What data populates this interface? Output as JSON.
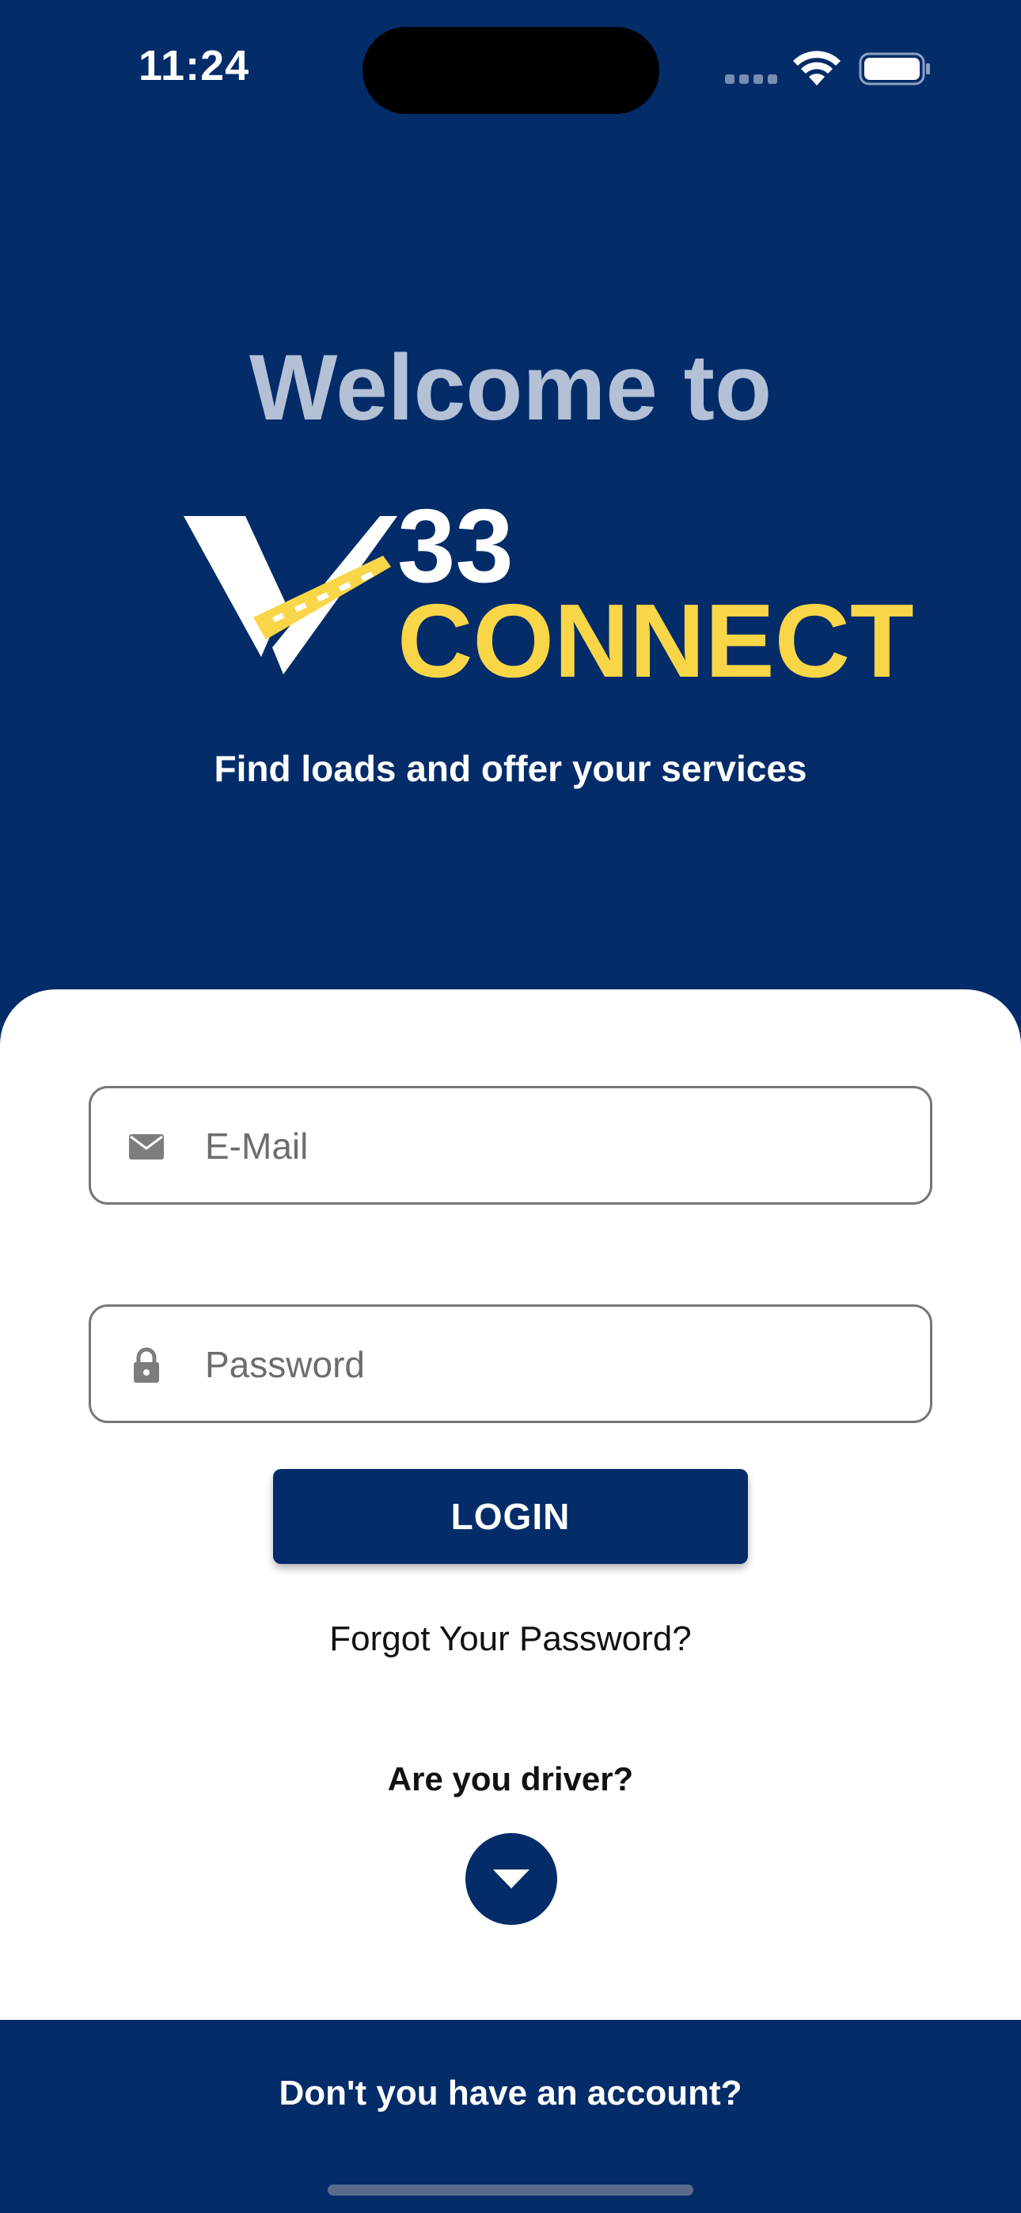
{
  "status_bar": {
    "time": "11:24",
    "icons": [
      "cellular-signal-icon",
      "wifi-icon",
      "battery-icon"
    ]
  },
  "header": {
    "welcome": "Welcome to",
    "logo_number": "33",
    "logo_word": "CONNECT",
    "tagline": "Find loads and offer your services"
  },
  "form": {
    "email_placeholder": "E-Mail",
    "email_icon": "mail-icon",
    "password_placeholder": "Password",
    "password_icon": "lock-icon",
    "login_label": "LOGIN",
    "forgot_password": "Forgot Your Password?"
  },
  "driver": {
    "question": "Are you driver?",
    "toggle_icon": "caret-down-icon"
  },
  "footer": {
    "signup_prompt": "Don't you have an account?"
  },
  "colors": {
    "primary": "#032c69",
    "accent_yellow": "#f9d648",
    "welcome_text": "#b3c0d6",
    "card_background": "#ffffff"
  }
}
